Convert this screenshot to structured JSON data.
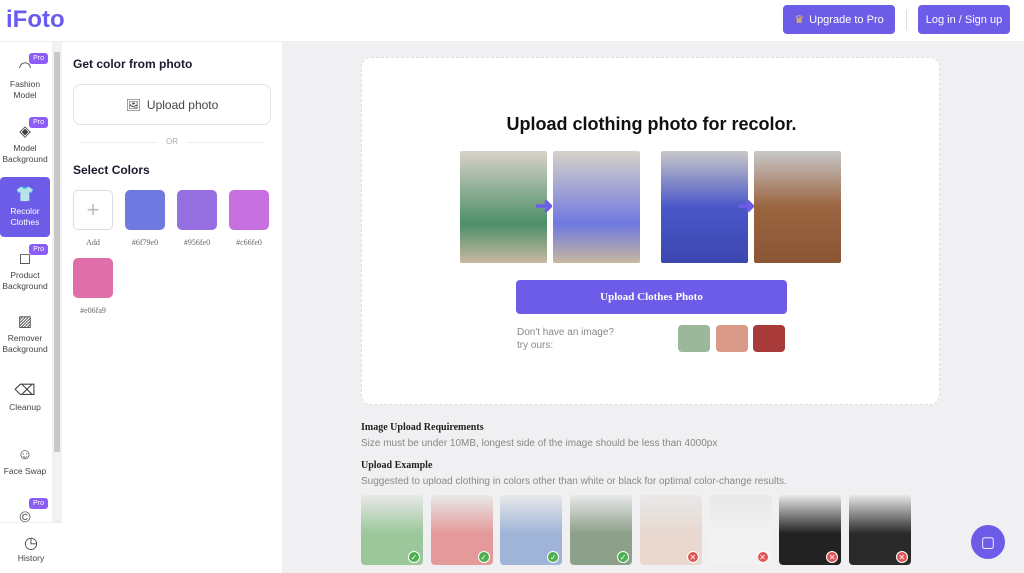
{
  "header": {
    "logo": "iFoto",
    "upgrade": "Upgrade to Pro",
    "login": "Log in / Sign up"
  },
  "nav": [
    {
      "label": "Fashion Model",
      "icon": "headset-icon",
      "glyph": "◠",
      "pro": true
    },
    {
      "label": "Model Background",
      "icon": "layers-icon",
      "glyph": "◈",
      "pro": true
    },
    {
      "label": "Recolor Clothes",
      "icon": "shirt-icon",
      "glyph": "👕",
      "pro": false,
      "active": true
    },
    {
      "label": "Product Background",
      "icon": "bag-icon",
      "glyph": "◻",
      "pro": true
    },
    {
      "label": "Remover Background",
      "icon": "stripes-icon",
      "glyph": "▨",
      "pro": false
    },
    {
      "label": "Cleanup",
      "icon": "eraser-icon",
      "glyph": "⌫",
      "pro": false
    },
    {
      "label": "Face Swap",
      "icon": "face-swap-icon",
      "glyph": "☺",
      "pro": false
    },
    {
      "label": "Recopyright",
      "icon": "copyright-icon",
      "glyph": "©",
      "pro": true
    }
  ],
  "pro_label": "Pro",
  "history": "History",
  "panel": {
    "title": "Get color from photo",
    "upload": "Upload photo",
    "or": "OR",
    "select": "Select Colors",
    "add": "Add",
    "colors": [
      "#6f79e0",
      "#956fe0",
      "#c66fe0",
      "#e06fa9"
    ]
  },
  "main": {
    "title": "Upload clothing photo for recolor.",
    "button": "Upload Clothes Photo",
    "try1": "Don't have an image?",
    "try2": "try ours:",
    "req_title": "Image Upload Requirements",
    "req_text": "Size must be under 10MB, longest side of the image should be less than 4000px",
    "ex_title": "Upload Example",
    "ex_text": "Suggested to upload clothing in colors other than white or black for optimal color-change results.",
    "examples": [
      {
        "ok": true,
        "c": "#9bc79b"
      },
      {
        "ok": true,
        "c": "#e49a9a"
      },
      {
        "ok": true,
        "c": "#9fb4d8"
      },
      {
        "ok": true,
        "c": "#8da08a"
      },
      {
        "ok": false,
        "c": "#e8d8cf"
      },
      {
        "ok": false,
        "c": "#f2f2f2"
      },
      {
        "ok": false,
        "c": "#222222"
      },
      {
        "ok": false,
        "c": "#2a2a2a"
      }
    ]
  },
  "accent": "#6c5ce7"
}
